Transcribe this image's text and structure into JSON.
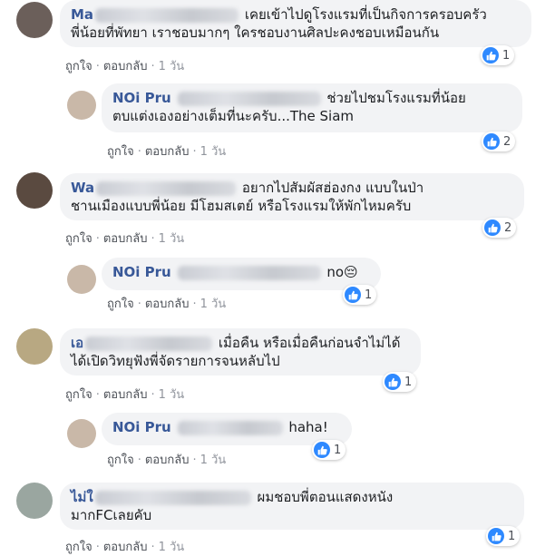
{
  "common": {
    "like": "ถูกใจ",
    "reply": "ตอบกลับ",
    "dot": "·",
    "time": "1 วัน"
  },
  "comments": [
    {
      "author_prefix": "Ma",
      "text_line1": "เคยเข้าไปดูโรงแรมที่เป็นกิจการครอบครัว",
      "text_line2": "พี่น้อยที่พัทยา เราชอบมากๆ ใครชอบงานศิลปะคงชอบเหมือนกัน",
      "likes": "1"
    },
    {
      "author": "NOi Pru",
      "text_line1": "ช่วยไปชมโรงแรมที่น้อย",
      "text_line2": "ตบแต่งเองอย่างเต็มที่นะครับ...The Siam",
      "likes": "2"
    },
    {
      "author_prefix": "Wa",
      "text_line1": "อยากไปสัมผัสฮ่องกง แบบในป่า",
      "text_line2": "ชานเมืองแบบพี่น้อย มีโฮมสเตย์ หรือโรงแรมให้พักไหมครับ",
      "likes": "2"
    },
    {
      "author": "NOi Pru",
      "text_line1": "no😔",
      "likes": "1"
    },
    {
      "author_prefix": "เอ",
      "text_line1": "เมื่อคืน หรือเมื่อคืนก่อนจำไม่ได้",
      "text_line2": "ได้เปิดวิทยุฟังพี่จัดรายการจนหลับไป",
      "likes": "1"
    },
    {
      "author": "NOi Pru",
      "text_line1": "haha!",
      "likes": "1"
    },
    {
      "author_prefix": "ไม่ใ",
      "text_line1": "ผมชอบพี่ตอนแสดงหนัง",
      "text_line2": "มากFCเลยคับ",
      "likes": "1"
    }
  ]
}
